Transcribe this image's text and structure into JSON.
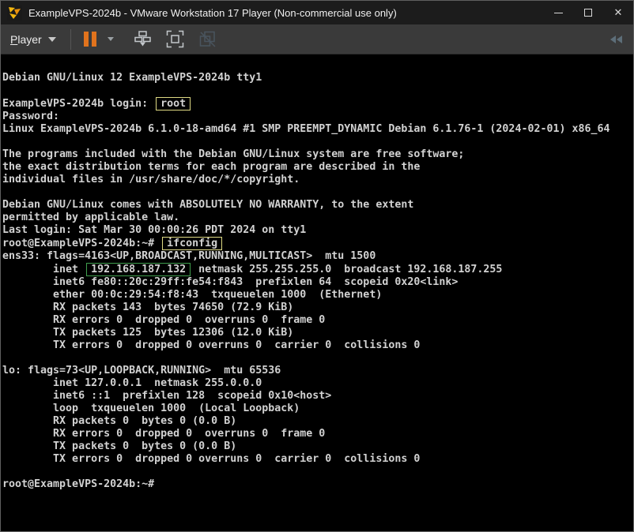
{
  "window": {
    "title": "ExampleVPS-2024b - VMware Workstation 17 Player (Non-commercial use only)",
    "close_glyph": "✕"
  },
  "toolbar": {
    "player_initial": "P",
    "player_rest": "layer"
  },
  "icons": {
    "logo": "vmware-player-logo",
    "suspend": "pause-bars",
    "send_cad": "ctrl-alt-del",
    "fullscreen": "enter-fullscreen",
    "unity": "unity-mode-disabled",
    "collapse": "chevrons-left"
  },
  "colors": {
    "accent_orange": "#e1731d",
    "annotation_yellow": "#ded983",
    "annotation_green": "#3f9e4d",
    "terminal_text": "#d2d2d2",
    "terminal_bg": "#000000",
    "titlebar_bg": "#1c1c1c",
    "toolbar_bg": "#3a3a3a"
  },
  "terminal": {
    "lines": [
      [
        {
          "t": "Debian GNU/Linux 12 ExampleVPS-2024b tty1"
        }
      ],
      [],
      [
        {
          "t": "ExampleVPS-2024b login: "
        },
        {
          "t": "root",
          "hl": "yellow",
          "name": "login-user-annotation"
        }
      ],
      [
        {
          "t": "Password:"
        }
      ],
      [
        {
          "t": "Linux ExampleVPS-2024b 6.1.0-18-amd64 #1 SMP PREEMPT_DYNAMIC Debian 6.1.76-1 (2024-02-01) x86_64"
        }
      ],
      [],
      [
        {
          "t": "The programs included with the Debian GNU/Linux system are free software;"
        }
      ],
      [
        {
          "t": "the exact distribution terms for each program are described in the"
        }
      ],
      [
        {
          "t": "individual files in /usr/share/doc/*/copyright."
        }
      ],
      [],
      [
        {
          "t": "Debian GNU/Linux comes with ABSOLUTELY NO WARRANTY, to the extent"
        }
      ],
      [
        {
          "t": "permitted by applicable law."
        }
      ],
      [
        {
          "t": "Last login: Sat Mar 30 00:00:26 PDT 2024 on tty1"
        }
      ],
      [
        {
          "t": "root@ExampleVPS-2024b:~# "
        },
        {
          "t": "ifconfig",
          "hl": "yellow",
          "name": "command-annotation"
        }
      ],
      [
        {
          "t": "ens33: flags=4163<UP,BROADCAST,RUNNING,MULTICAST>  mtu 1500"
        }
      ],
      [
        {
          "t": "        inet "
        },
        {
          "t": "192.168.187.132",
          "hl": "green",
          "name": "ip-address-annotation"
        },
        {
          "t": " netmask 255.255.255.0  broadcast 192.168.187.255"
        }
      ],
      [
        {
          "t": "        inet6 fe80::20c:29ff:fe54:f843  prefixlen 64  scopeid 0x20<link>"
        }
      ],
      [
        {
          "t": "        ether 00:0c:29:54:f8:43  txqueuelen 1000  (Ethernet)"
        }
      ],
      [
        {
          "t": "        RX packets 143  bytes 74650 (72.9 KiB)"
        }
      ],
      [
        {
          "t": "        RX errors 0  dropped 0  overruns 0  frame 0"
        }
      ],
      [
        {
          "t": "        TX packets 125  bytes 12306 (12.0 KiB)"
        }
      ],
      [
        {
          "t": "        TX errors 0  dropped 0 overruns 0  carrier 0  collisions 0"
        }
      ],
      [],
      [
        {
          "t": "lo: flags=73<UP,LOOPBACK,RUNNING>  mtu 65536"
        }
      ],
      [
        {
          "t": "        inet 127.0.0.1  netmask 255.0.0.0"
        }
      ],
      [
        {
          "t": "        inet6 ::1  prefixlen 128  scopeid 0x10<host>"
        }
      ],
      [
        {
          "t": "        loop  txqueuelen 1000  (Local Loopback)"
        }
      ],
      [
        {
          "t": "        RX packets 0  bytes 0 (0.0 B)"
        }
      ],
      [
        {
          "t": "        RX errors 0  dropped 0  overruns 0  frame 0"
        }
      ],
      [
        {
          "t": "        TX packets 0  bytes 0 (0.0 B)"
        }
      ],
      [
        {
          "t": "        TX errors 0  dropped 0 overruns 0  carrier 0  collisions 0"
        }
      ],
      [],
      [
        {
          "t": "root@ExampleVPS-2024b:~#"
        }
      ]
    ]
  }
}
